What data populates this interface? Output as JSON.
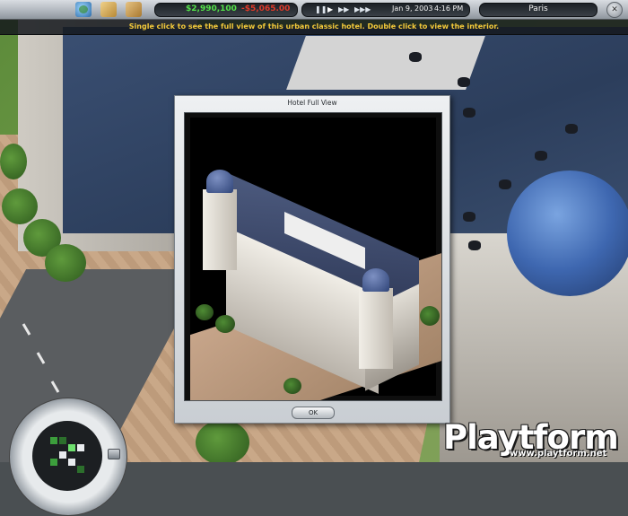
{
  "topbar": {
    "money": "$2,990,100",
    "expense": "-$5,065.00",
    "date": "Jan 9, 2003",
    "time": "4:16 PM",
    "city": "Paris",
    "controls": [
      "pause",
      "play",
      "fast-forward",
      "faster"
    ],
    "icons": [
      "globe-icon",
      "boxes-icon",
      "card-icon",
      "close-icon"
    ]
  },
  "hint": {
    "text": "Single click to see the full view of this urban classic hotel. Double click to view the interior."
  },
  "dialog": {
    "title": "Hotel Full View",
    "ok_label": "OK"
  },
  "watermark": {
    "logo": "Playtform",
    "url": "www.playtform.net"
  },
  "colors": {
    "money": "#54e24a",
    "expense": "#e03a2a",
    "hint": "#f3c93a"
  }
}
